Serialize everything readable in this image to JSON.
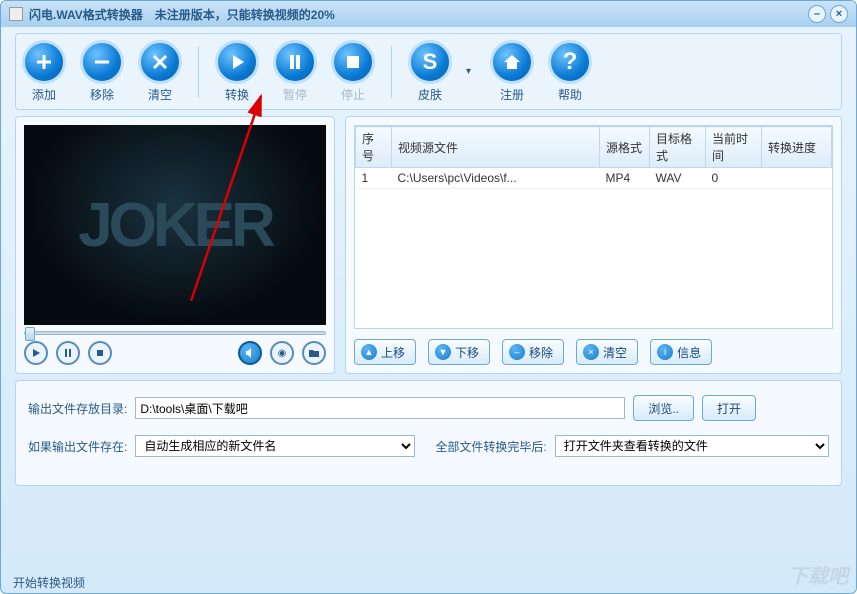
{
  "title": "闪电.WAV格式转换器　未注册版本，只能转换视频的20%",
  "toolbar": {
    "add": "添加",
    "remove": "移除",
    "clear": "清空",
    "convert": "转换",
    "pause": "暂停",
    "stop": "停止",
    "skin": "皮肤",
    "register": "注册",
    "help": "帮助"
  },
  "preview_text": "JOKER",
  "table": {
    "headers": [
      "序号",
      "视频源文件",
      "源格式",
      "目标格式",
      "当前时间",
      "转换进度"
    ],
    "rows": [
      {
        "idx": "1",
        "src": "C:\\Users\\pc\\Videos\\f...",
        "sfmt": "MP4",
        "tfmt": "WAV",
        "time": "0",
        "prog": ""
      }
    ]
  },
  "list_buttons": {
    "up": "上移",
    "down": "下移",
    "remove": "移除",
    "clear": "清空",
    "info": "信息"
  },
  "form": {
    "out_dir_label": "输出文件存放目录:",
    "out_dir_value": "D:\\tools\\桌面\\下载吧",
    "browse": "浏览..",
    "open": "打开",
    "exists_label": "如果输出文件存在:",
    "exists_value": "自动生成相应的新文件名",
    "after_label": "全部文件转换完毕后:",
    "after_value": "打开文件夹查看转换的文件"
  },
  "status": "开始转换视频",
  "watermark": "下载吧"
}
